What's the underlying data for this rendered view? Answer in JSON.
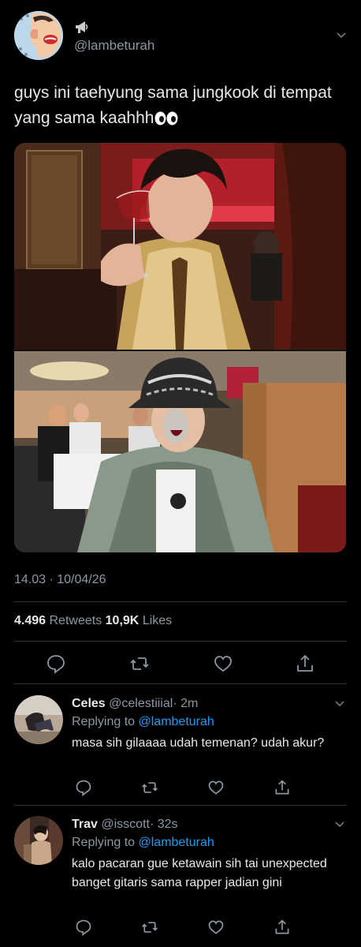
{
  "tweet": {
    "handle": "@lambeturah",
    "text": "guys ini taehyung sama jungkook di tempat yang sama kaahhh",
    "emoji_icon": "eyes-emoji-icon",
    "timestamp": "14.03 · 10/04/26",
    "retweets_count": "4.496",
    "retweets_label": "Retweets",
    "likes_count": "10,9K",
    "likes_label": "Likes"
  },
  "replies": [
    {
      "name": "Celes",
      "handle": "@celestiiial",
      "time": "· 2m",
      "replying_label": "Replying to",
      "replying_to": "@lambeturah",
      "text": "masa sih gilaaaa udah temenan? udah akur?"
    },
    {
      "name": "Trav",
      "handle": "@isscott",
      "time": "· 32s",
      "replying_label": "Replying to",
      "replying_to": "@lambeturah",
      "text": "kalo pacaran gue ketawain sih tai unexpected banget gitaris sama rapper jadian gini"
    }
  ],
  "icons": {
    "reply": "comment-icon",
    "retweet": "retweet-icon",
    "like": "heart-icon",
    "share": "share-icon",
    "more": "chevron-down-icon",
    "verified_sound": "megaphone-icon"
  },
  "colors": {
    "background": "#000000",
    "text": "#e7e9ea",
    "muted": "#8b98a5",
    "link": "#1d9bf0",
    "divider": "#2f3336"
  }
}
